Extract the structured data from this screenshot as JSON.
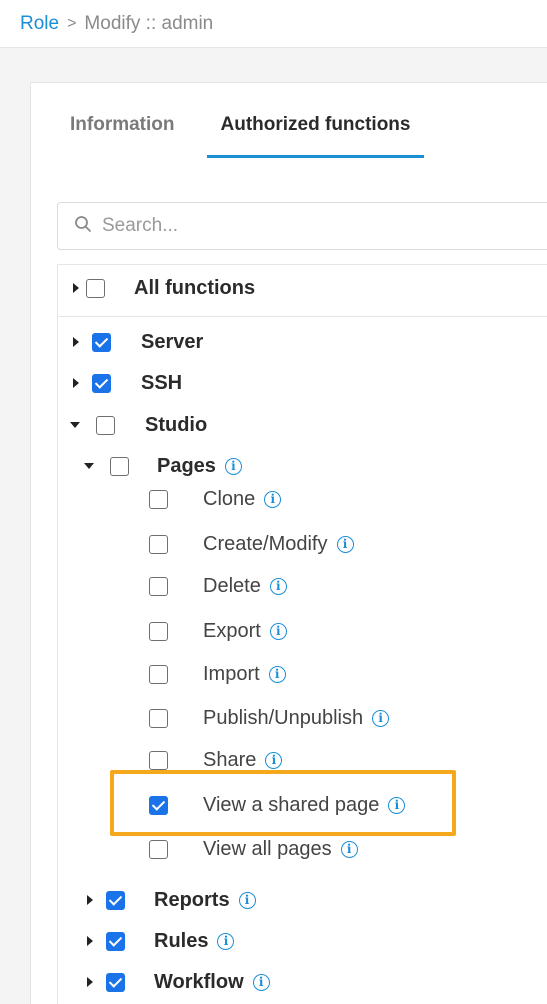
{
  "breadcrumb": {
    "root": "Role",
    "separator": ">",
    "current": "Modify :: admin"
  },
  "tabs": [
    {
      "label": "Information",
      "active": false
    },
    {
      "label": "Authorized functions",
      "active": true
    }
  ],
  "search": {
    "placeholder": "Search..."
  },
  "tree": {
    "all": {
      "label": "All functions",
      "checked": false
    },
    "server": {
      "label": "Server",
      "checked": true
    },
    "ssh": {
      "label": "SSH",
      "checked": true
    },
    "studio": {
      "label": "Studio",
      "checked": false,
      "expanded": true
    },
    "pages": {
      "label": "Pages",
      "checked": false,
      "expanded": true,
      "items": [
        {
          "label": "Clone",
          "checked": false
        },
        {
          "label": "Create/Modify",
          "checked": false
        },
        {
          "label": "Delete",
          "checked": false
        },
        {
          "label": "Export",
          "checked": false
        },
        {
          "label": "Import",
          "checked": false
        },
        {
          "label": "Publish/Unpublish",
          "checked": false
        },
        {
          "label": "Share",
          "checked": false
        },
        {
          "label": "View a shared page",
          "checked": true
        },
        {
          "label": "View all pages",
          "checked": false
        }
      ]
    },
    "reports": {
      "label": "Reports",
      "checked": true
    },
    "rules": {
      "label": "Rules",
      "checked": true
    },
    "workflow": {
      "label": "Workflow",
      "checked": true
    }
  },
  "icons": {
    "info": "i",
    "search": "search-icon"
  },
  "colors": {
    "accent": "#1a8fd6",
    "checkbox": "#1a73e8",
    "highlight": "#f5a81c"
  }
}
